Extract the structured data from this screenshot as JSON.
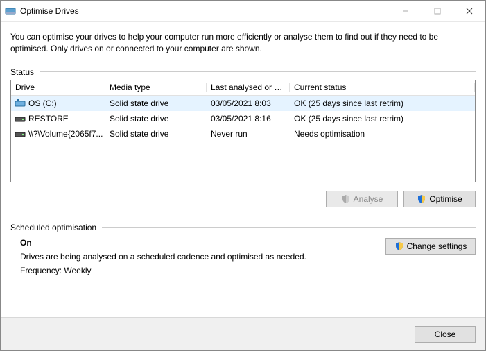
{
  "window": {
    "title": "Optimise Drives"
  },
  "intro": "You can optimise your drives to help your computer run more efficiently or analyse them to find out if they need to be optimised. Only drives on or connected to your computer are shown.",
  "status_label": "Status",
  "columns": {
    "drive": "Drive",
    "media": "Media type",
    "last": "Last analysed or o...",
    "status": "Current status"
  },
  "drives": [
    {
      "name": "OS (C:)",
      "media": "Solid state drive",
      "last": "03/05/2021 8:03",
      "status": "OK (25 days since last retrim)",
      "icon": "os-drive-icon",
      "selected": true
    },
    {
      "name": "RESTORE",
      "media": "Solid state drive",
      "last": "03/05/2021 8:16",
      "status": "OK (25 days since last retrim)",
      "icon": "drive-icon",
      "selected": false
    },
    {
      "name": "\\\\?\\Volume{2065f7...",
      "media": "Solid state drive",
      "last": "Never run",
      "status": "Needs optimisation",
      "icon": "drive-icon",
      "selected": false
    }
  ],
  "buttons": {
    "analyse": "Analyse",
    "optimise": "Optimise",
    "change_settings": "Change settings",
    "close": "Close"
  },
  "scheduled": {
    "label": "Scheduled optimisation",
    "on": "On",
    "desc": "Drives are being analysed on a scheduled cadence and optimised as needed.",
    "freq": "Frequency: Weekly"
  }
}
